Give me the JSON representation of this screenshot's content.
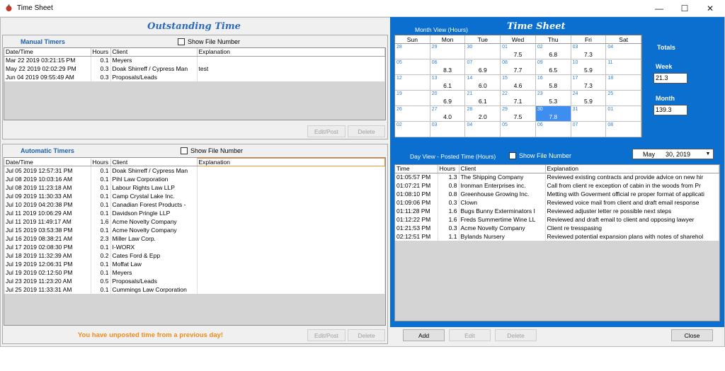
{
  "window": {
    "title": "Time Sheet",
    "minimize": "—",
    "maximize": "☐",
    "close": "✕"
  },
  "left": {
    "heading": "Outstanding Time",
    "manual": {
      "label": "Manual Timers",
      "show_file_number": "Show File Number",
      "columns": [
        "Date/Time",
        "Hours",
        "Client",
        "Explanation"
      ],
      "rows": [
        [
          "Mar 22 2019 03:21:15 PM",
          "0.1",
          "Meyers",
          ""
        ],
        [
          "May 22 2019 02:02:29 PM",
          "0.3",
          "Doak Shirreff / Cypress Man",
          "test"
        ],
        [
          "Jun 04 2019 09:55:49 AM",
          "0.3",
          "Proposals/Leads",
          ""
        ]
      ],
      "edit_post": "Edit/Post",
      "delete": "Delete"
    },
    "automatic": {
      "label": "Automatic Timers",
      "show_file_number": "Show File Number",
      "columns": [
        "Date/Time",
        "Hours",
        "Client",
        "Explanation"
      ],
      "rows": [
        [
          "Jul 05 2019 12:57:31 PM",
          "0.1",
          "Doak Shirreff / Cypress Man",
          ""
        ],
        [
          "Jul 08 2019 10:03:16 AM",
          "0.1",
          "Pihl Law Corporation",
          ""
        ],
        [
          "Jul 08 2019 11:23:18 AM",
          "0.1",
          "Labour Rights Law LLP",
          ""
        ],
        [
          "Jul 09 2019 11:30:33 AM",
          "0.1",
          "Camp Crystal Lake Inc.",
          ""
        ],
        [
          "Jul 10 2019 04:20:38 PM",
          "0.1",
          "Canadian Forest Products -",
          ""
        ],
        [
          "Jul 11 2019 10:06:29 AM",
          "0.1",
          "Davidson Pringle LLP",
          ""
        ],
        [
          "Jul 11 2019 11:49:17 AM",
          "1.6",
          "Acme Novelty Company",
          ""
        ],
        [
          "Jul 15 2019 03:53:38 PM",
          "0.1",
          "Acme Novelty Company",
          ""
        ],
        [
          "Jul 16 2019 08:38:21 AM",
          "2.3",
          "Miller Law Corp.",
          ""
        ],
        [
          "Jul 17 2019 02:08:30 PM",
          "0.1",
          "I-WORX",
          ""
        ],
        [
          "Jul 18 2019 11:32:39 AM",
          "0.2",
          "Cates Ford & Epp",
          ""
        ],
        [
          "Jul 19 2019 12:06:31 PM",
          "0.1",
          "Moffat Law",
          ""
        ],
        [
          "Jul 19 2019 02:12:50 PM",
          "0.1",
          "Meyers",
          ""
        ],
        [
          "Jul 23 2019 11:23:20 AM",
          "0.5",
          "Proposals/Leads",
          ""
        ],
        [
          "Jul 25 2019 11:33:31 AM",
          "0.1",
          "Cummings Law Corporation",
          ""
        ]
      ],
      "edit_post": "Edit/Post",
      "delete": "Delete"
    },
    "warning": "You have unposted time from a previous day!"
  },
  "right": {
    "heading": "Time Sheet",
    "month_view_label": "Month View (Hours)",
    "weekdays": [
      "Sun",
      "Mon",
      "Tue",
      "Wed",
      "Thu",
      "Fri",
      "Sat"
    ],
    "weeks": [
      [
        [
          "28",
          ""
        ],
        [
          "29",
          ""
        ],
        [
          "30",
          ""
        ],
        [
          "01",
          "7.5"
        ],
        [
          "02",
          "6.8"
        ],
        [
          "03",
          "7.3"
        ],
        [
          "04",
          ""
        ]
      ],
      [
        [
          "05",
          ""
        ],
        [
          "06",
          "8.3"
        ],
        [
          "07",
          "6.9"
        ],
        [
          "08",
          "7.7"
        ],
        [
          "09",
          "6.5"
        ],
        [
          "10",
          "5.9"
        ],
        [
          "11",
          ""
        ]
      ],
      [
        [
          "12",
          ""
        ],
        [
          "13",
          "6.1"
        ],
        [
          "14",
          "6.0"
        ],
        [
          "15",
          "4.6"
        ],
        [
          "16",
          "5.8"
        ],
        [
          "17",
          "7.3"
        ],
        [
          "18",
          ""
        ]
      ],
      [
        [
          "19",
          ""
        ],
        [
          "20",
          "6.9"
        ],
        [
          "21",
          "6.1"
        ],
        [
          "22",
          "7.1"
        ],
        [
          "23",
          "5.3"
        ],
        [
          "24",
          "5.9"
        ],
        [
          "25",
          ""
        ]
      ],
      [
        [
          "26",
          ""
        ],
        [
          "27",
          "4.0"
        ],
        [
          "28",
          "2.0"
        ],
        [
          "29",
          "7.5"
        ],
        [
          "30",
          "7.8"
        ],
        [
          "31",
          ""
        ],
        [
          "01",
          ""
        ]
      ],
      [
        [
          "02",
          ""
        ],
        [
          "03",
          ""
        ],
        [
          "04",
          ""
        ],
        [
          "05",
          ""
        ],
        [
          "06",
          ""
        ],
        [
          "07",
          ""
        ],
        [
          "08",
          ""
        ]
      ]
    ],
    "selected_day": "30",
    "totals_label": "Totals",
    "week_label": "Week",
    "week_value": "21.3",
    "month_label": "Month",
    "month_value": "139.3",
    "day_view_label": "Day View - Posted Time (Hours)",
    "show_file_number": "Show File Number",
    "date_select": "May      30, 2019",
    "day": {
      "columns": [
        "Time",
        "Hours",
        "Client",
        "Explanation"
      ],
      "rows": [
        [
          "01:05:57 PM",
          "1.3",
          "The Shipping Company",
          "Reviewed existing contracts and provide advice on new hir"
        ],
        [
          "01:07:21 PM",
          "0.8",
          "Ironman Enterprises inc.",
          "Call from client re exception of cabin in the woods from Pr"
        ],
        [
          "01:08:10 PM",
          "0.8",
          "Greenhouse Growing Inc.",
          "Metting with Goverment official re proper format of applicati"
        ],
        [
          "01:09:06 PM",
          "0.3",
          "Clown",
          "Reviewed voice mail from client and draft email response"
        ],
        [
          "01:11:28 PM",
          "1.6",
          "Bugs Bunny Exterminators I",
          "Reviewed adjuster letter re possible next steps"
        ],
        [
          "01:12:22 PM",
          "1.6",
          "Freds Summertime Wine LL",
          "Reviewed and draft email to client and opposing lawyer"
        ],
        [
          "01:21:53 PM",
          "0.3",
          "Acme Novelty Company",
          "Client re tresspasing"
        ],
        [
          "02:12:51 PM",
          "1.1",
          "Bylands Nursery",
          "Reviewed potential expansion plans with notes of sharehol"
        ]
      ]
    },
    "add": "Add",
    "edit": "Edit",
    "delete": "Delete",
    "close": "Close"
  },
  "colors": {
    "accent_blue": "#0a6fcf",
    "warning_orange": "#f08a18",
    "heading_blue": "#2a6ab8"
  }
}
